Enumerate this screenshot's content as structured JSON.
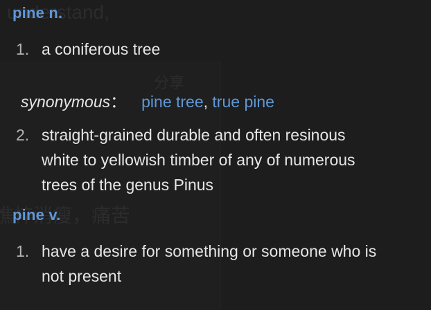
{
  "background_ghost": {
    "line1": "understand,",
    "line2": "分享",
    "line3": "憔悴消瘦，痛苦"
  },
  "entries": [
    {
      "heading": "pine n.",
      "senses": [
        {
          "number": "1.",
          "definition": "a coniferous tree",
          "synonyms_label": "synonymous",
          "synonyms_colon": "：",
          "synonyms": [
            "pine tree",
            "true pine"
          ],
          "synonym_separator": ","
        },
        {
          "number": "2.",
          "definition_lines": [
            "straight-grained durable and often resinous",
            "white to yellowish timber of any of numerous",
            "trees of the genus Pinus"
          ]
        }
      ]
    },
    {
      "heading": "pine v.",
      "senses": [
        {
          "number": "1.",
          "definition_lines": [
            "have a desire for something or someone who is",
            "not present"
          ]
        }
      ]
    }
  ],
  "colors": {
    "background": "#1d1d1e",
    "heading": "#5f97d6",
    "link": "#5f97d6",
    "text": "#e6e6e6",
    "number": "#b4b4b4"
  }
}
